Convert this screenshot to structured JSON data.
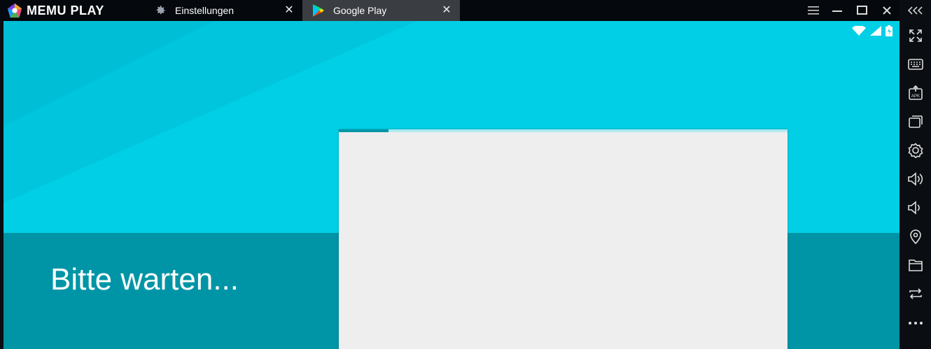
{
  "app": {
    "brand": "MEMU PLAY"
  },
  "tabs": [
    {
      "label": "Einstellungen",
      "icon": "gear-icon",
      "active": false
    },
    {
      "label": "Google Play",
      "icon": "play-store-icon",
      "active": true
    }
  ],
  "window_controls": [
    "menu-icon",
    "minimize-icon",
    "maximize-icon",
    "close-icon",
    "collapse-icon"
  ],
  "sidebar": {
    "buttons": [
      "fullscreen-icon",
      "keyboard-icon",
      "apk-install-icon",
      "multi-window-icon",
      "settings-icon",
      "volume-up-icon",
      "volume-down-icon",
      "location-icon",
      "folder-icon",
      "rotate-icon",
      "more-icon"
    ]
  },
  "android": {
    "status_icons": [
      "wifi-icon",
      "signal-icon",
      "battery-icon"
    ],
    "wait_text": "Bitte warten...",
    "progress": 0.11
  },
  "colors": {
    "teal_light": "#00cfe5",
    "teal_dark": "#0095a6",
    "card": "#eeeeee",
    "progress": "#0097a7"
  }
}
